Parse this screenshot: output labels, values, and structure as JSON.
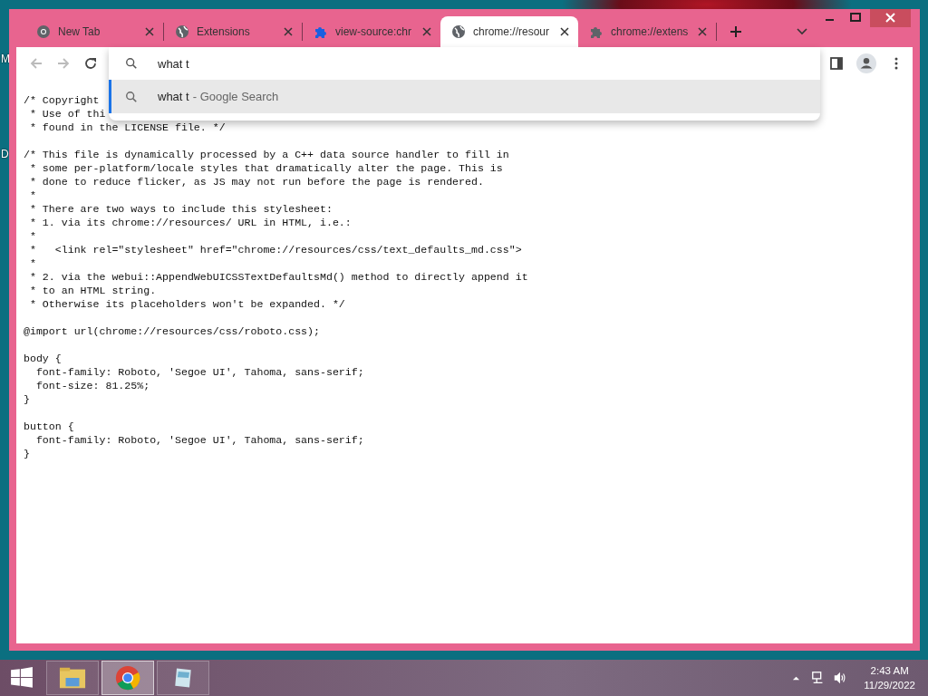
{
  "desktop_labels": [
    "M",
    "D"
  ],
  "window": {
    "tabs": [
      {
        "title": "New Tab",
        "kind": "chrome",
        "selected": false
      },
      {
        "title": "Extensions",
        "kind": "globe",
        "selected": false
      },
      {
        "title": "view-source:chr",
        "kind": "extension",
        "selected": false
      },
      {
        "title": "chrome://resour",
        "kind": "globe",
        "selected": true
      },
      {
        "title": "chrome://extens",
        "kind": "extensions-page",
        "selected": false
      }
    ]
  },
  "omnibox": {
    "value": "what t",
    "suggestions": [
      {
        "query": "what t",
        "description": "- Google Search",
        "selected": true
      }
    ]
  },
  "code": [
    [
      "/* Copyright",
      " * Use of thi",
      " * found in the LICENSE file. */"
    ],
    [
      "/* This file is dynamically processed by a C++ data source handler to fill in",
      " * some per-platform/locale styles that dramatically alter the page. This is",
      " * done to reduce flicker, as JS may not run before the page is rendered.",
      " *",
      " * There are two ways to include this stylesheet:",
      " * 1. via its chrome://resources/ URL in HTML, i.e.:",
      " *",
      " *   <link rel=\"stylesheet\" href=\"chrome://resources/css/text_defaults_md.css\">",
      " *",
      " * 2. via the webui::AppendWebUICSSTextDefaultsMd() method to directly append it",
      " * to an HTML string.",
      " * Otherwise its placeholders won't be expanded. */"
    ],
    [
      "@import url(chrome://resources/css/roboto.css);"
    ],
    [
      "body {",
      "  font-family: Roboto, 'Segoe UI', Tahoma, sans-serif;",
      "  font-size: 81.25%;",
      "}"
    ],
    [
      "button {",
      "  font-family: Roboto, 'Segoe UI', Tahoma, sans-serif;",
      "}"
    ]
  ],
  "taskbar": {
    "apps": [
      {
        "kind": "explorer",
        "selected": false
      },
      {
        "kind": "chrome",
        "selected": true
      },
      {
        "kind": "notepad",
        "selected": false
      }
    ],
    "time": "2:43 AM",
    "date": "11/29/2022"
  }
}
